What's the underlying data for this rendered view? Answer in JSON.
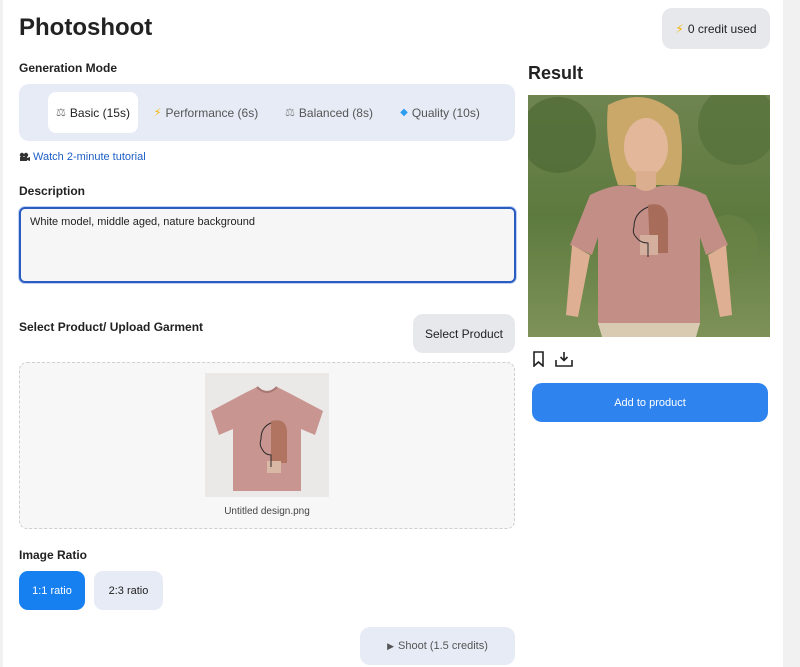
{
  "header": {
    "title": "Photoshoot",
    "credit_label": "0 credit used"
  },
  "generation_mode": {
    "label": "Generation Mode",
    "tabs": [
      {
        "label": "Basic (15s)",
        "icon": "scale-icon",
        "active": true
      },
      {
        "label": "Performance (6s)",
        "icon": "lightning-icon",
        "active": false
      },
      {
        "label": "Balanced (8s)",
        "icon": "scale-icon",
        "active": false
      },
      {
        "label": "Quality (10s)",
        "icon": "diamond-icon",
        "active": false
      }
    ]
  },
  "tutorial": {
    "label": "Watch 2-minute tutorial",
    "icon": "camera-icon"
  },
  "description": {
    "label": "Description",
    "value": "White model, middle aged, nature background"
  },
  "product": {
    "label": "Select Product/ Upload Garment",
    "select_label": "Select Product",
    "filename": "Untitled design.png"
  },
  "ratio": {
    "label": "Image Ratio",
    "options": [
      {
        "label": "1:1 ratio",
        "active": true
      },
      {
        "label": "2:3 ratio",
        "active": false
      }
    ]
  },
  "shoot": {
    "label": "Shoot (1.5 credits)",
    "icon": "play-icon"
  },
  "result": {
    "title": "Result",
    "add_label": "Add to product"
  },
  "colors": {
    "accent": "#1680f0",
    "button_blue": "#2f83ee",
    "tab_bg": "#e6ebf6",
    "link": "#1d5fc6"
  }
}
